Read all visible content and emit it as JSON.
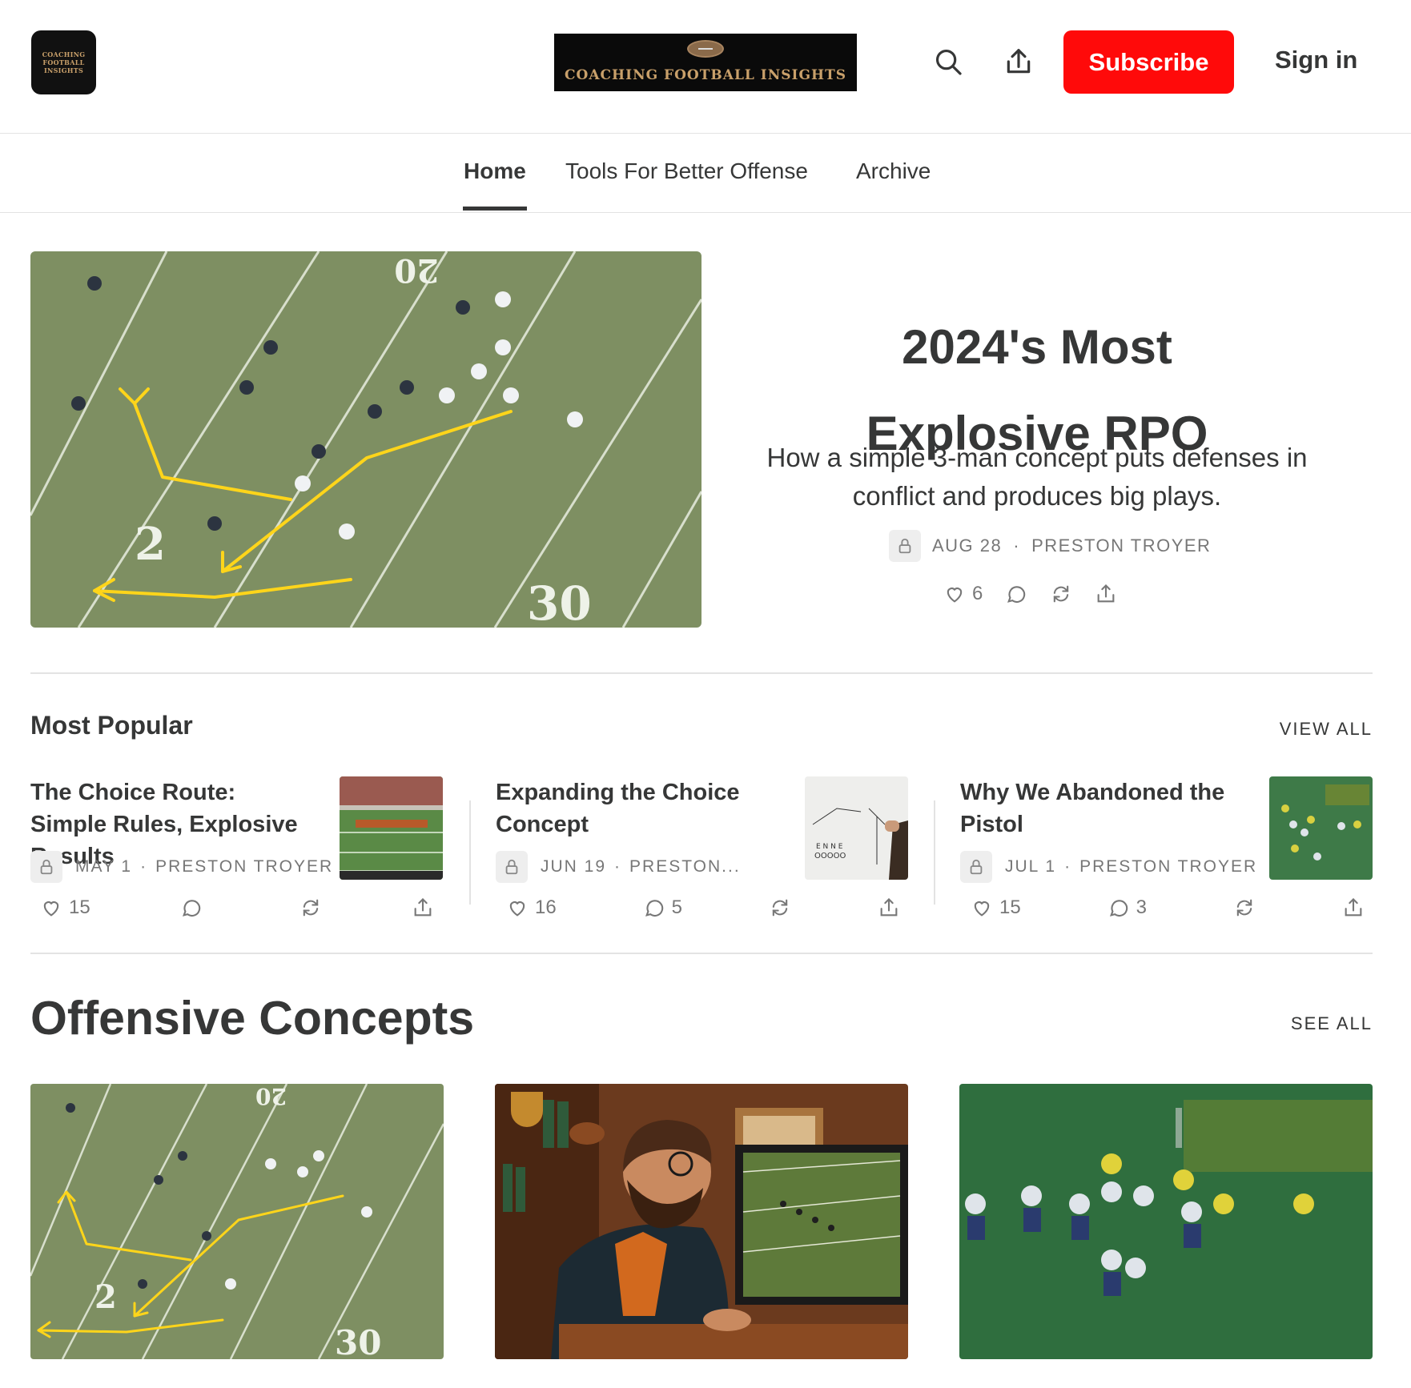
{
  "header": {
    "app_icon_text": "COACHING FOOTBALL INSIGHTS",
    "brand_text": "COACHING FOOTBALL INSIGHTS",
    "search_icon": "search-icon",
    "share_icon": "share-icon",
    "subscribe_label": "Subscribe",
    "signin_label": "Sign in",
    "accent_color": "#ff0a0a"
  },
  "nav": {
    "tabs": [
      {
        "label": "Home",
        "active": true
      },
      {
        "label": "Tools For Better Offense",
        "active": false
      },
      {
        "label": "Archive",
        "active": false
      }
    ]
  },
  "hero": {
    "title_line1": "2024's Most",
    "title_line2": "Explosive RPO",
    "subtitle_line1": "How a simple 3-man concept puts defenses in",
    "subtitle_line2": "conflict and produces big plays.",
    "date": "AUG 28",
    "author": "PRESTON TROYER",
    "likes": "6"
  },
  "most_popular": {
    "heading": "Most Popular",
    "view_all": "VIEW ALL",
    "posts": [
      {
        "title": "The Choice Route: Simple Rules, Explosive Results",
        "date": "MAY 1",
        "author": "PRESTON TROYER",
        "likes": "15",
        "comments": ""
      },
      {
        "title": "Expanding the Choice Concept",
        "date": "JUN 19",
        "author": "PRESTON...",
        "likes": "16",
        "comments": "5"
      },
      {
        "title": "Why We Abandoned the Pistol",
        "date": "JUL 1",
        "author": "PRESTON TROYER",
        "likes": "15",
        "comments": "3"
      }
    ]
  },
  "offensive_concepts": {
    "heading": "Offensive Concepts",
    "see_all": "SEE ALL"
  },
  "separator": "·"
}
